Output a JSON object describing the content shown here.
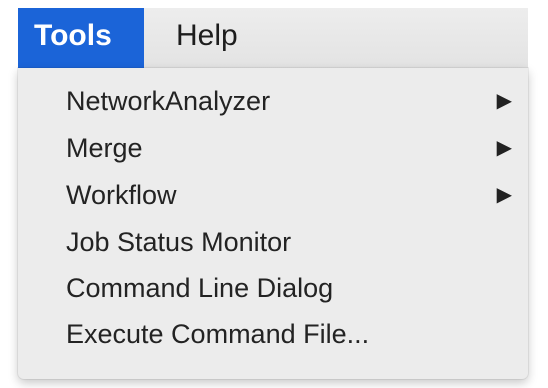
{
  "menubar": {
    "items": [
      {
        "label": "Tools",
        "active": true
      },
      {
        "label": "Help",
        "active": false
      }
    ]
  },
  "tools_menu": {
    "items": [
      {
        "label": "NetworkAnalyzer",
        "has_submenu": true
      },
      {
        "label": "Merge",
        "has_submenu": true
      },
      {
        "label": "Workflow",
        "has_submenu": true
      },
      {
        "label": "Job Status Monitor",
        "has_submenu": false
      },
      {
        "label": "Command Line Dialog",
        "has_submenu": false
      },
      {
        "label": "Execute Command File...",
        "has_submenu": false
      }
    ],
    "submenu_arrow_glyph": "▶"
  },
  "colors": {
    "active_menu_bg": "#1b64d8",
    "menu_bg": "#ececec",
    "text": "#232323"
  }
}
